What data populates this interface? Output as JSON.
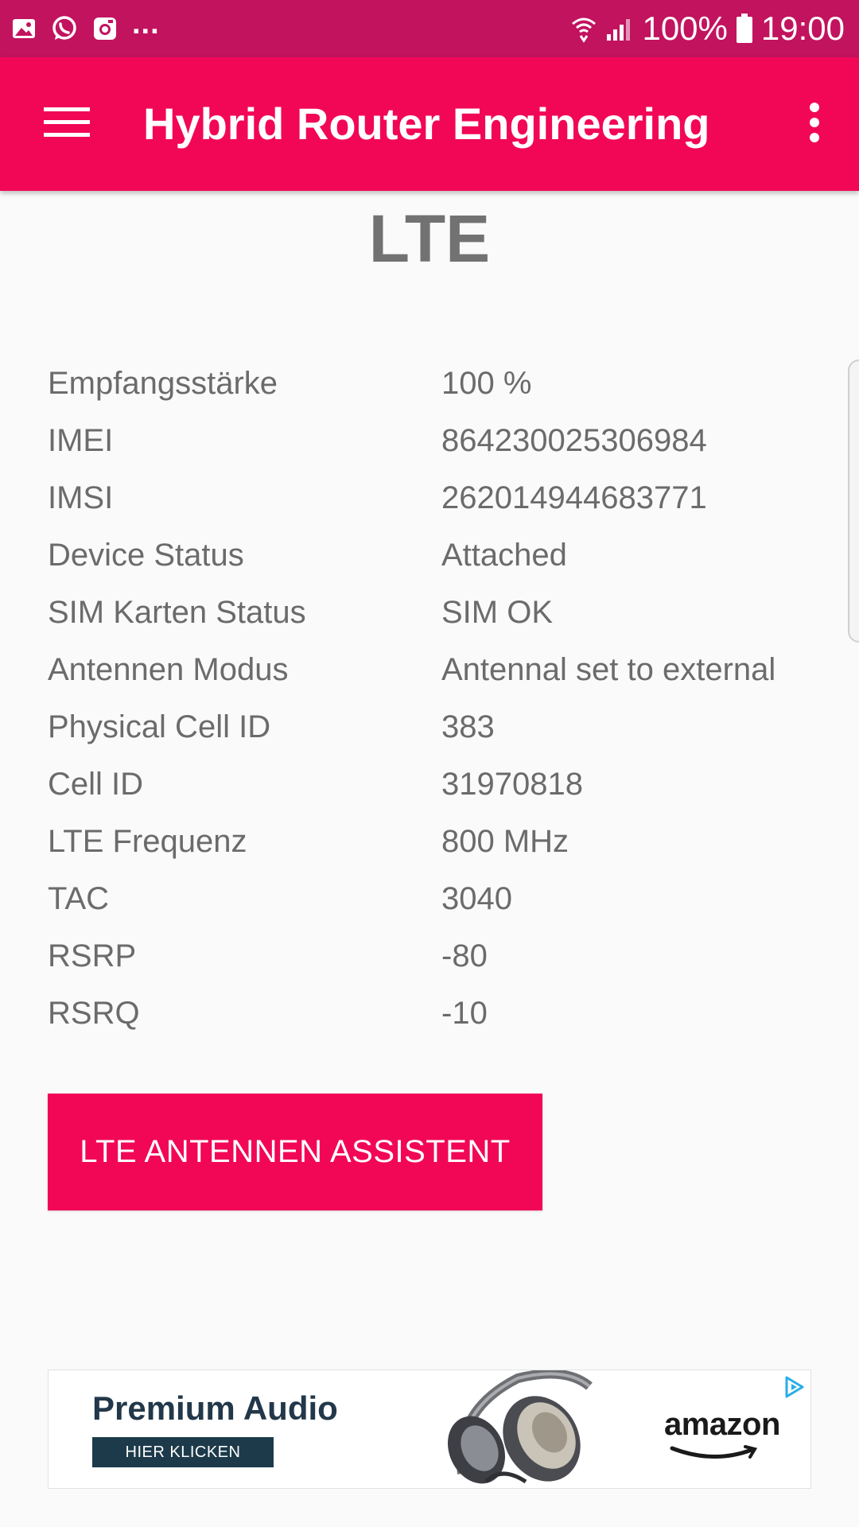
{
  "status_bar": {
    "overflow_indicator": "...",
    "battery_percent": "100%",
    "time": "19:00"
  },
  "app_bar": {
    "title": "Hybrid Router Engineering",
    "menu_icon": "hamburger-menu-icon",
    "overflow_icon": "vertical-dots-icon"
  },
  "section": {
    "title": "LTE"
  },
  "rows": [
    {
      "label": "Empfangsstärke",
      "value": "100 %"
    },
    {
      "label": "IMEI",
      "value": "864230025306984"
    },
    {
      "label": "IMSI",
      "value": "262014944683771"
    },
    {
      "label": "Device Status",
      "value": "Attached"
    },
    {
      "label": "SIM Karten Status",
      "value": "SIM OK"
    },
    {
      "label": "Antennen Modus",
      "value": "Antennal set to external"
    },
    {
      "label": "Physical Cell ID",
      "value": "383"
    },
    {
      "label": "Cell ID",
      "value": "31970818"
    },
    {
      "label": "LTE Frequenz",
      "value": "800 MHz"
    },
    {
      "label": "TAC",
      "value": "3040"
    },
    {
      "label": "RSRP",
      "value": "-80"
    },
    {
      "label": "RSRQ",
      "value": "-10"
    }
  ],
  "actions": {
    "assistant_label": "LTE ANTENNEN ASSISTENT"
  },
  "ad": {
    "headline": "Premium Audio",
    "cta": "HIER KLICKEN",
    "brand": "amazon"
  },
  "colors": {
    "status_bar": "#c2135f",
    "app_bar": "#f20756",
    "accent": "#f20756",
    "text": "#6b6b6b",
    "title": "#727272",
    "background": "#fafafa"
  }
}
